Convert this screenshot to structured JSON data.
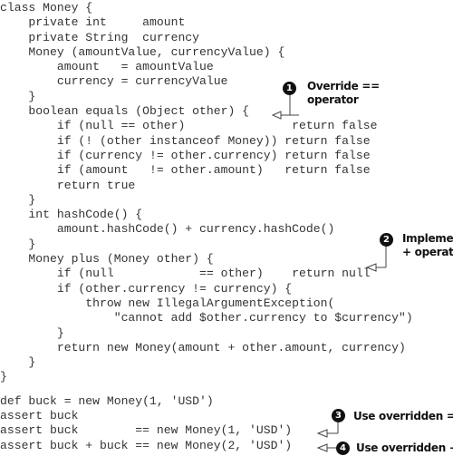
{
  "code": {
    "class_block": [
      "class Money {",
      "    private int     amount",
      "    private String  currency",
      "    Money (amountValue, currencyValue) {",
      "        amount   = amountValue",
      "        currency = currencyValue",
      "    }",
      "    boolean equals (Object other) {",
      "        if (null == other)               return false",
      "        if (! (other instanceof Money)) return false",
      "        if (currency != other.currency) return false",
      "        if (amount   != other.amount)   return false",
      "        return true",
      "    }",
      "    int hashCode() {",
      "        amount.hashCode() + currency.hashCode()",
      "    }",
      "    Money plus (Money other) {",
      "        if (null            == other)    return null",
      "        if (other.currency != currency) {",
      "            throw new IllegalArgumentException(",
      "                \"cannot add $other.currency to $currency\")",
      "        }",
      "        return new Money(amount + other.amount, currency)",
      "    }",
      "}"
    ],
    "script_block": [
      "def buck = new Money(1, 'USD')",
      "assert buck",
      "assert buck        == new Money(1, 'USD')",
      "assert buck + buck == new Money(2, 'USD')"
    ]
  },
  "callouts": [
    {
      "number": "1",
      "line1": "Override ==",
      "line2": "operator"
    },
    {
      "number": "2",
      "line1": "Implement",
      "line2": "+ operator"
    },
    {
      "number": "3",
      "line1": "Use overridden ==",
      "line2": ""
    },
    {
      "number": "4",
      "line1": "Use overridden +",
      "line2": ""
    }
  ]
}
